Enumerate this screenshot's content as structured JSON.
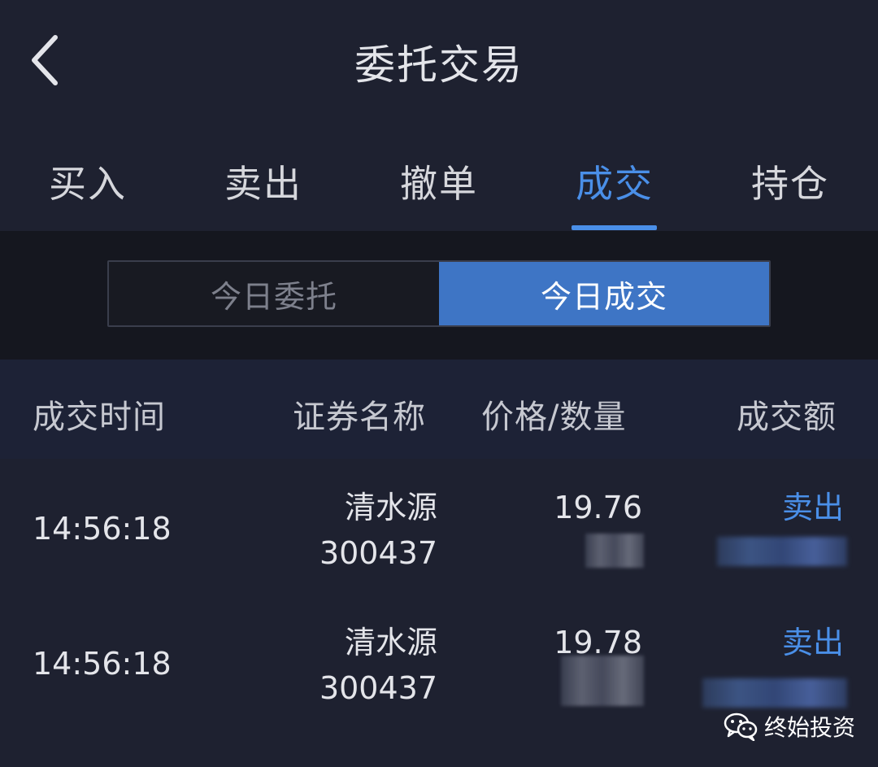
{
  "header": {
    "title": "委托交易"
  },
  "tabs": [
    {
      "label": "买入",
      "active": false
    },
    {
      "label": "卖出",
      "active": false
    },
    {
      "label": "撤单",
      "active": false
    },
    {
      "label": "成交",
      "active": true
    },
    {
      "label": "持仓",
      "active": false
    }
  ],
  "segment": {
    "left_label": "今日委托",
    "right_label": "今日成交",
    "selected": "今日成交"
  },
  "columns": {
    "time": "成交时间",
    "name": "证券名称",
    "price_qty": "价格/数量",
    "amount": "成交额"
  },
  "rows": [
    {
      "time": "14:56:18",
      "name": "清水源",
      "code": "300437",
      "price": "19.76",
      "direction": "卖出"
    },
    {
      "time": "14:56:18",
      "name": "清水源",
      "code": "300437",
      "price": "19.78",
      "direction": "卖出"
    }
  ],
  "watermark": {
    "text": "终始投资",
    "logo": "wechat-logo"
  },
  "colors": {
    "background": "#1e2130",
    "accent": "#4a8fe8",
    "segment_active": "#3e75c5",
    "header_row": "#1d2236"
  }
}
